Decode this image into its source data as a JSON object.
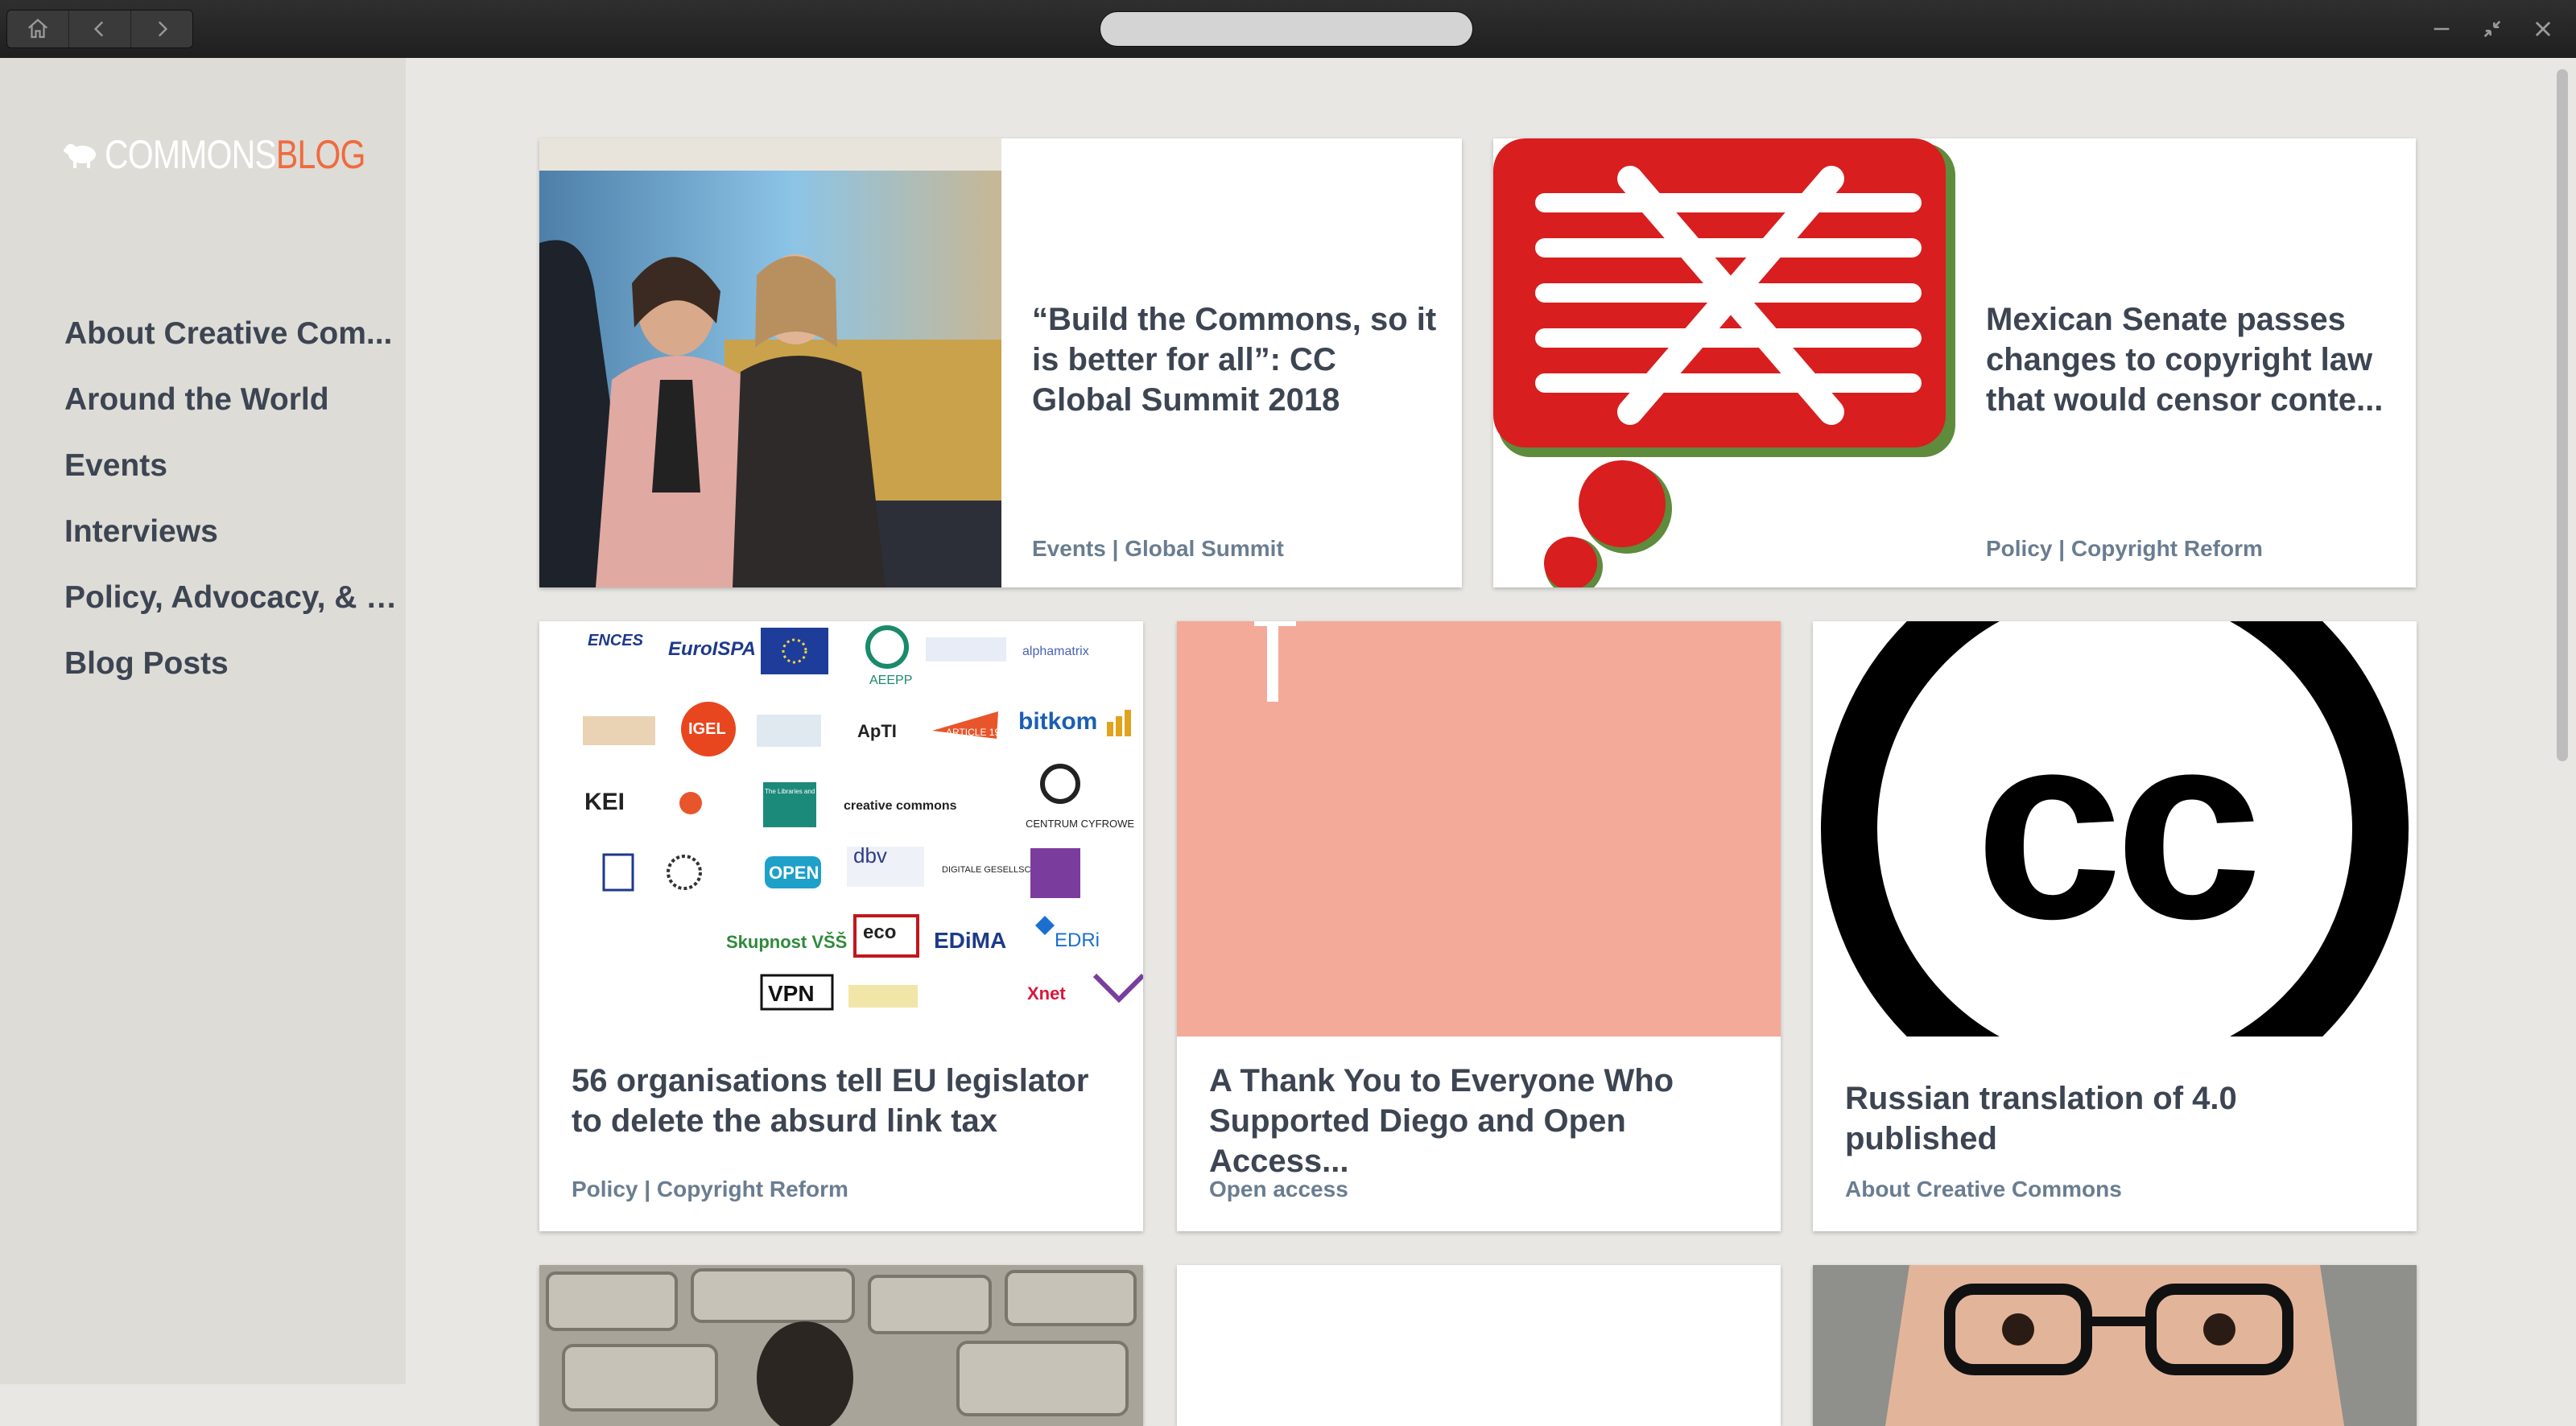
{
  "toolbar": {
    "search": {
      "value": "",
      "placeholder": ""
    }
  },
  "logo": {
    "part1": "COMMONS",
    "part2": "BLOG"
  },
  "sidebar": {
    "items": [
      {
        "label": "About Creative Com..."
      },
      {
        "label": "Around the World"
      },
      {
        "label": "Events"
      },
      {
        "label": "Interviews"
      },
      {
        "label": "Policy, Advocacy, & C..."
      },
      {
        "label": "Blog Posts"
      }
    ]
  },
  "posts": [
    {
      "title": "“Build the Commons, so it is better for all”:  CC Global Summit 2018",
      "category": "Events | Global Summit"
    },
    {
      "title": "Mexican Senate passes changes to copyright law that would censor conte...",
      "category": "Policy | Copyright Reform"
    },
    {
      "title": "56 organisations tell EU legislator to delete the absurd link tax",
      "category": "Policy | Copyright Reform"
    },
    {
      "title": "A Thank You to Everyone Who Supported Diego and Open Access...",
      "category": "Open access"
    },
    {
      "title": "Russian translation of 4.0 published",
      "category": "About Creative Commons"
    }
  ],
  "cc_logo_text": "cc",
  "logo_wall": [
    "ENCES",
    "EuroISPA",
    "AEEPP",
    "alphamatrix",
    "IGEL",
    "ApTI",
    "ARTICLE 19",
    "bitkom",
    "KEI",
    "The Libraries and Archives Copyright Alliance",
    "creative commons",
    "CENTRUM CYFROWE",
    "OPEN",
    "dbv",
    "DIGITALE GESELLSCHAFT",
    "Skupnost VŠŠ",
    "eco",
    "EDiMA",
    "EDRi",
    "VPN",
    "Xnet"
  ],
  "colors": {
    "accent": "#ef6b3f",
    "text": "#3d4452",
    "category": "#6a7d90",
    "salmon": "#f4aa98",
    "red": "#d81e1e"
  }
}
